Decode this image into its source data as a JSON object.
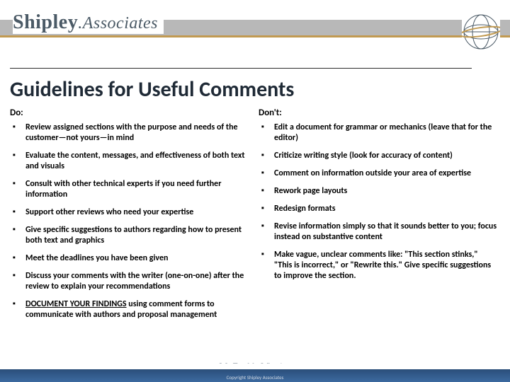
{
  "brand": {
    "name_bold": "Shipley",
    "name_light": "Associates"
  },
  "title": "Guidelines for Useful Comments",
  "columns": {
    "left": {
      "heading": "Do:",
      "items": [
        {
          "text": "Review assigned sections with the purpose and needs of the customer—not yours—in mind"
        },
        {
          "text": "Evaluate the content, messages, and effectiveness of both text and visuals"
        },
        {
          "text": "Consult with other technical experts if you need further information"
        },
        {
          "text": "Support other reviews who need your expertise"
        },
        {
          "text": "Give specific suggestions to authors regarding how to present both text and graphics"
        },
        {
          "text": "Meet the deadlines you have been given"
        },
        {
          "text": "Discuss your comments with the writer (one-on-one) after the review to explain your recommendations"
        },
        {
          "prefix": "DOCUMENT YOUR FINDINGS",
          "prefix_underline": true,
          "rest": " using comment forms to communicate with authors and proposal management"
        }
      ]
    },
    "right": {
      "heading": "Don't:",
      "items": [
        {
          "text": "Edit a document for grammar or mechanics (leave that for the editor)"
        },
        {
          "text": "Criticize writing style (look for accuracy of content)"
        },
        {
          "text": "Comment on information outside your area of expertise"
        },
        {
          "text": "Rework page layouts"
        },
        {
          "text": "Redesign formats"
        },
        {
          "text": "Revise information simply so that it sounds better to you; focus instead on substantive content"
        },
        {
          "text": "Make vague, unclear comments like: \"This section stinks,\" \"This is incorrect,\" or \"Rewrite this.\" Give specific suggestions to improve the section."
        }
      ]
    }
  },
  "footer": {
    "tagline": "We Enable Winning",
    "copyright": "Copyright Shipley Associates"
  }
}
